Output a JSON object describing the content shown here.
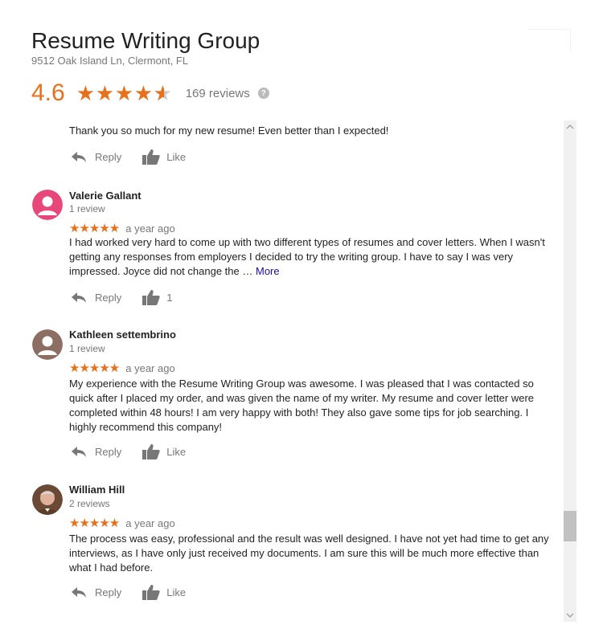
{
  "business": {
    "name": "Resume Writing Group",
    "address": "9512 Oak Island Ln, Clermont, FL",
    "rating": "4.6",
    "rating_value": 4.6,
    "review_count": "169 reviews"
  },
  "colors": {
    "star": "#e7711b",
    "link": "#1a0dab",
    "muted": "#777777"
  },
  "icons": {
    "reply": "reply-arrow-icon",
    "like": "thumbs-up-icon",
    "help": "help-circle-icon"
  },
  "reviews": [
    {
      "text": "Thank you so much for my new resume! Even better than I expected!",
      "reply_label": "Reply",
      "like_label": "Like"
    },
    {
      "name": "Valerie Gallant",
      "count": "1 review",
      "stars": "★★★★★",
      "time": "a year ago",
      "text": "I had worked very hard to come up with two different types of resumes and cover letters. When I wasn't getting any responses from employers I decided to try the writing group. I have to say I was very impressed. Joyce  did not change the …",
      "more_label": "More",
      "reply_label": "Reply",
      "like_label": "1"
    },
    {
      "name": "Kathleen settembrino",
      "count": "1 review",
      "stars": "★★★★★",
      "time": "a year ago",
      "text": "My experience with the Resume Writing Group was awesome.  I was pleased that I was contacted so quick after I placed my order, and was given the name of my writer. My resume and cover letter were completed within 48 hours! I am very happy with both! They also gave some tips for job searching.  I highly recommend this company!",
      "reply_label": "Reply",
      "like_label": "Like"
    },
    {
      "name": "William Hill",
      "count": "2 reviews",
      "stars": "★★★★★",
      "time": "a year ago",
      "text": "The process was easy, professional and the result was well designed.  I have not yet had time to get any interviews, as I have only just received my documents.  I am sure this will be much more effective than what I had before.",
      "reply_label": "Reply",
      "like_label": "Like"
    }
  ]
}
